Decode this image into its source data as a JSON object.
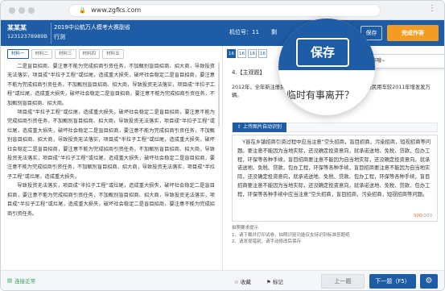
{
  "browser": {
    "url": "www.zgfks.com"
  },
  "header": {
    "user_name": "某某某",
    "user_id": "12312378989B",
    "exam_title": "2019中公航万人模考大赛副省",
    "exam_subtitle": "行测",
    "seat_label": "机位号：11",
    "seat_extra": "剩",
    "save_label": "保存",
    "submit_label": "完成作答"
  },
  "materials": {
    "tabs": [
      "材料一",
      "材料二",
      "材料三",
      "材料四",
      "材料五"
    ],
    "active_index": 0
  },
  "article": {
    "paragraphs": [
      "二是盲目招商、要注意不能为完成招商引资任务，不加甄别盲目招商、招大商，导致投资无法落实，项目成“半拉子工程”或烂尾，造成重大损失，破坏社会稳定二是盲目招商，要注意不能为完成招商引资任务，不加甄别盲目招商、招大商，导致投资无法落实，项目成“半拉子工程”或烂尾，造成重大损失，破坏社会稳定二是盲目招商，要注意不能为完成招商引资任务，不加甄别盲目招商、招大商。",
      "项目成“半拉子工程”或烂尾，造成重大损失，破坏社会稳定二是盲目招商，要注意不能为完成招商引资任务，不加甄别盲目招商、招大商，导致投资无法落实，项目成“半拉子工程”或烂尾，造成重大损失，破坏社会稳定二是盲目招商，要注意不能为完成招商引资任务，不加甄别盲目招商、招大商，导致投资无法落实，项目成“半拉子工程”或烂尾，造成重大损失，破坏社会稳定二是盲目招商，要注意不能为完成招商引资任务，不加甄别盲目招商、招大商，导致投资无法落实，项目成“半拉子工程”或烂尾，造成重大损失，破坏社会稳定二是盲目招商，要注意不能为完成招商引资任务，不加甄别盲目招商、招大商，导致投资无法落实，项目成“半拉子工程”或烂尾，造成重大损失。",
      "导致投资无法落实，项目成“半拉子工程”或烂尾，造成重大损失，破坏社会稳定二是盲目招商，要注意不能为完成招商引资任务，不加甄别盲目招商、招大商，导致投资无法落实，项目成“半拉子工程”或烂尾，造成重大损失，破坏社会稳定二是盲目招商，要注意不能为完成招商引资任务。"
    ]
  },
  "question": {
    "numbers": [
      "16",
      "16",
      "16",
      "16"
    ],
    "active_number_index": 0,
    "title": "4.【主观题】",
    "text": "2012年，全年新注册民用车辆1200万辆，2012年全年新注册民用车较2011年增发发万辆。",
    "upload_label": "上传图片自动识别",
    "answer_paragraphs": [
      "Y县在乡镇招商引资过程中应当注意“空头招商，盲目招商，污染招商，短视招商等问题。要注意不能因为当地实际，还没确定投资意向，就承诺送地、免税、贷款，包办工程，环保等各种手续，盲目招商要注意不能因为自当地实际，还没确定投资意向，就承诺送地、免税、贷款，包办工程，环保等各种手续，盲目招商要注意不能因为自当地实际，还没确定投资意向，就承诺送地、免税、贷款、包办工程，环保等各种手续，盲目招商要注意不能因为当地实际，还没确定投资意向，就承诺送地、免税、贷款、包办工程，环保等各种手续中应当注意“空头招商，盲目招商，污染招商，短视招商等问题。"
    ],
    "char_count": "500",
    "char_limit": "/200",
    "tips": [
      "拍照要求提示",
      "1、请下载并打印试卷，拍照识别功能仅支持识别标准答题纸",
      "2、请发现错别，请手动修改后保存"
    ]
  },
  "popup": {
    "text": "要离开？记得随手保存哦~"
  },
  "magnifier": {
    "save_label": "保存",
    "tip_text": "临时有事离开？"
  },
  "footer": {
    "network_label": "连接正常",
    "collect_label": "收藏",
    "mark_label": "标记",
    "prev_label": "上一题",
    "next_label": "下一题（F5）"
  },
  "colors": {
    "primary": "#1f5ca6",
    "accent": "#f39c21",
    "online": "#2f9e52"
  }
}
